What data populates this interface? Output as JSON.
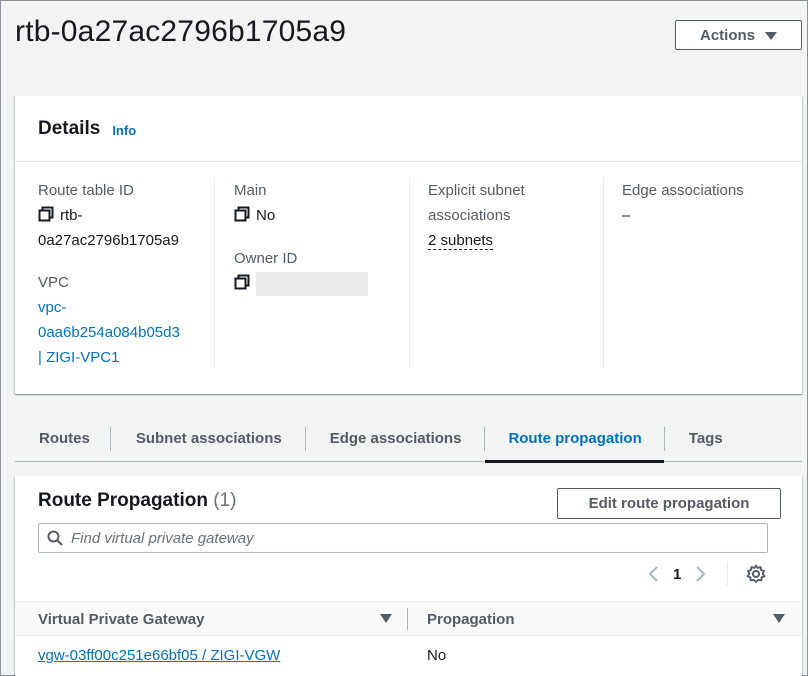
{
  "header": {
    "title": "rtb-0a27ac2796b1705a9",
    "actions_label": "Actions"
  },
  "details": {
    "title": "Details",
    "info": "Info",
    "route_table_id": {
      "label": "Route table ID",
      "value_line1": "rtb-",
      "value_line2": "0a27ac2796b1705a9"
    },
    "vpc": {
      "label": "VPC",
      "line1": "vpc-",
      "line2": "0aa6b254a084b05d3",
      "line3": "| ZIGI-VPC1"
    },
    "main": {
      "label": "Main",
      "value": "No"
    },
    "owner_id": {
      "label": "Owner ID"
    },
    "explicit_subnet": {
      "label_line1": "Explicit subnet",
      "label_line2": "associations",
      "value": "2 subnets"
    },
    "edge": {
      "label": "Edge associations",
      "value": "–"
    }
  },
  "tabs": [
    {
      "label": "Routes",
      "active": false
    },
    {
      "label": "Subnet associations",
      "active": false
    },
    {
      "label": "Edge associations",
      "active": false
    },
    {
      "label": "Route propagation",
      "active": true
    },
    {
      "label": "Tags",
      "active": false
    }
  ],
  "route_propagation": {
    "title": "Route Propagation",
    "count": "(1)",
    "edit_label": "Edit route propagation",
    "search_placeholder": "Find virtual private gateway",
    "page": "1",
    "columns": [
      "Virtual Private Gateway",
      "Propagation"
    ],
    "rows": [
      {
        "gateway": "vgw-03ff00c251e66bf05 / ZIGI-VGW",
        "propagation": "No"
      }
    ]
  },
  "colors": {
    "link": "#0073bb",
    "text": "#16191f",
    "muted": "#545b64",
    "background": "#f2f3f3"
  }
}
